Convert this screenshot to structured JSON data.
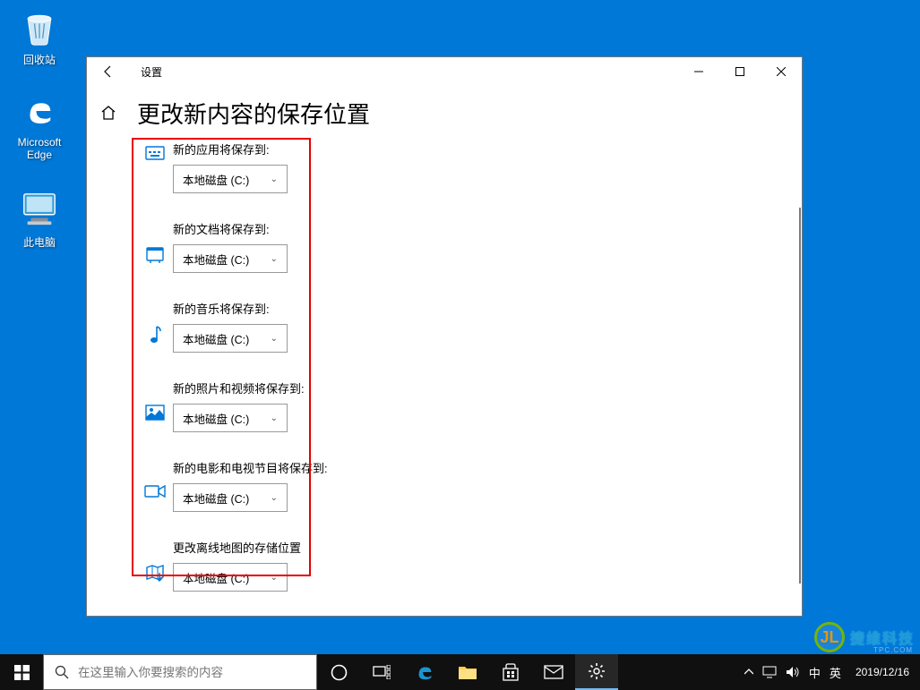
{
  "desktop": {
    "recycle": "回收站",
    "edge": "Microsoft Edge",
    "thispc": "此电脑"
  },
  "window": {
    "title": "设置",
    "page_title": "更改新内容的保存位置",
    "rows": [
      {
        "label": "新的应用将保存到:",
        "value": "本地磁盘 (C:)"
      },
      {
        "label": "新的文档将保存到:",
        "value": "本地磁盘 (C:)"
      },
      {
        "label": "新的音乐将保存到:",
        "value": "本地磁盘 (C:)"
      },
      {
        "label": "新的照片和视频将保存到:",
        "value": "本地磁盘 (C:)"
      },
      {
        "label": "新的电影和电视节目将保存到:",
        "value": "本地磁盘 (C:)"
      },
      {
        "label": "更改离线地图的存储位置",
        "value": "本地磁盘 (C:)"
      }
    ]
  },
  "taskbar": {
    "search_placeholder": "在这里输入你要搜索的内容",
    "ime1": "中",
    "ime2": "英",
    "date": "2019/12/16"
  },
  "watermark": {
    "brand": "捷维科技",
    "sub": "TPC.COM"
  }
}
